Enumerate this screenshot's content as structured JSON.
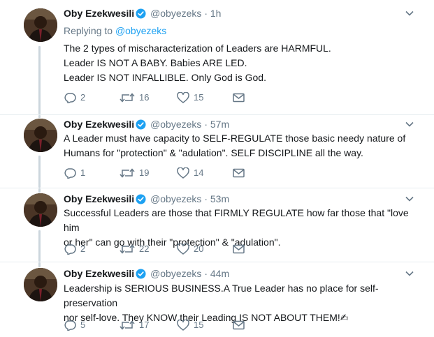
{
  "tweets": [
    {
      "name": "Oby Ezekwesili",
      "handle": "@obyezeks",
      "sep": "·",
      "time": "1h",
      "reply_prefix": "Replying to",
      "reply_handle": "@obyezeks",
      "lines": [
        "The 2 types of mischaracterization of Leaders are HARMFUL.",
        "Leader IS NOT A BABY. Babies ARE LED.",
        "Leader IS NOT INFALLIBLE. Only God is God."
      ],
      "replies": "2",
      "retweets": "16",
      "likes": "15"
    },
    {
      "name": "Oby Ezekwesili",
      "handle": "@obyezeks",
      "sep": "·",
      "time": "57m",
      "lines": [
        "A Leader must have capacity to SELF-REGULATE those basic needy nature of",
        "Humans for \"protection\" & \"adulation\". SELF DISCIPLINE all the way."
      ],
      "replies": "1",
      "retweets": "19",
      "likes": "14"
    },
    {
      "name": "Oby Ezekwesili",
      "handle": "@obyezeks",
      "sep": "·",
      "time": "53m",
      "lines": [
        "Successful Leaders are those that FIRMLY REGULATE how far those that \"love him",
        "or her\" can go with their \"protection\" & \"adulation\"."
      ],
      "replies": "2",
      "retweets": "22",
      "likes": "20"
    },
    {
      "name": "Oby Ezekwesili",
      "handle": "@obyezeks",
      "sep": "·",
      "time": "44m",
      "lines": [
        "Leadership is SERIOUS BUSINESS.A True Leader has no place for self-preservation",
        "nor self-love. They KNOW their Leading IS NOT ABOUT THEM!✍"
      ],
      "replies": "5",
      "retweets": "17",
      "likes": "15"
    }
  ],
  "icons": {
    "verified": "verified-badge-icon",
    "caret": "chevron-down-icon",
    "reply": "reply-icon",
    "retweet": "retweet-icon",
    "like": "heart-icon",
    "dm": "envelope-icon"
  },
  "colors": {
    "link": "#1da1f2",
    "muted": "#657786",
    "text": "#14171a",
    "divider": "#e6ecf0",
    "thread_line": "#ccd6dd"
  }
}
